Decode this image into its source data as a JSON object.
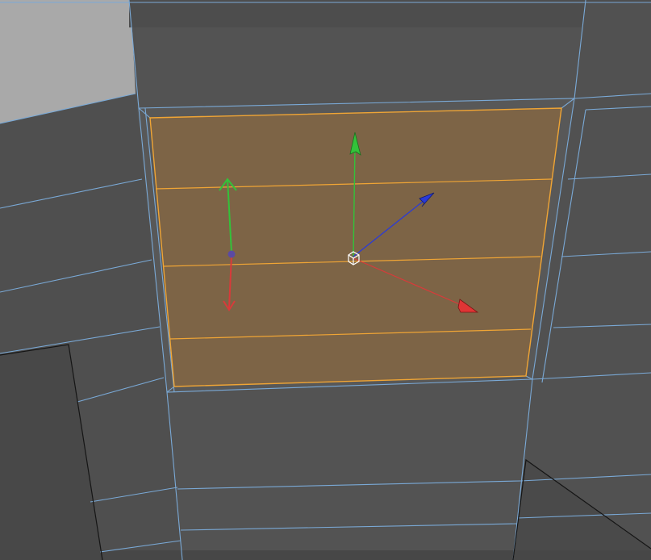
{
  "viewport": {
    "label": "",
    "colors": {
      "background": "#525252",
      "wall_face": "#535353",
      "wall_dark": "#4b4b4b",
      "wall_light": "#5a5a5a",
      "floor_light": "#a9a9a9",
      "wireframe": "#7aa9d6",
      "black_edge": "#151515",
      "selection_fill": "#7d6446",
      "selection_edge": "#f0a535"
    }
  },
  "selection": {
    "type": "polygon-face",
    "state": "selected"
  },
  "gizmos": {
    "move_gizmo": {
      "axes": [
        {
          "axis": "x",
          "color": "#d93a3a",
          "icon": "cone-arrow-icon"
        },
        {
          "axis": "y",
          "color": "#33c23a",
          "icon": "cone-arrow-icon"
        },
        {
          "axis": "z",
          "color": "#2a3ad8",
          "icon": "cone-arrow-icon"
        }
      ],
      "center_icon": "cube-outline-icon"
    },
    "pivot_gizmo": {
      "axes": [
        {
          "axis": "x",
          "color": "#d93a3a",
          "icon": "open-arrow-icon"
        },
        {
          "axis": "y",
          "color": "#33c23a",
          "icon": "open-arrow-icon"
        }
      ],
      "center_icon": "dot-icon"
    }
  }
}
